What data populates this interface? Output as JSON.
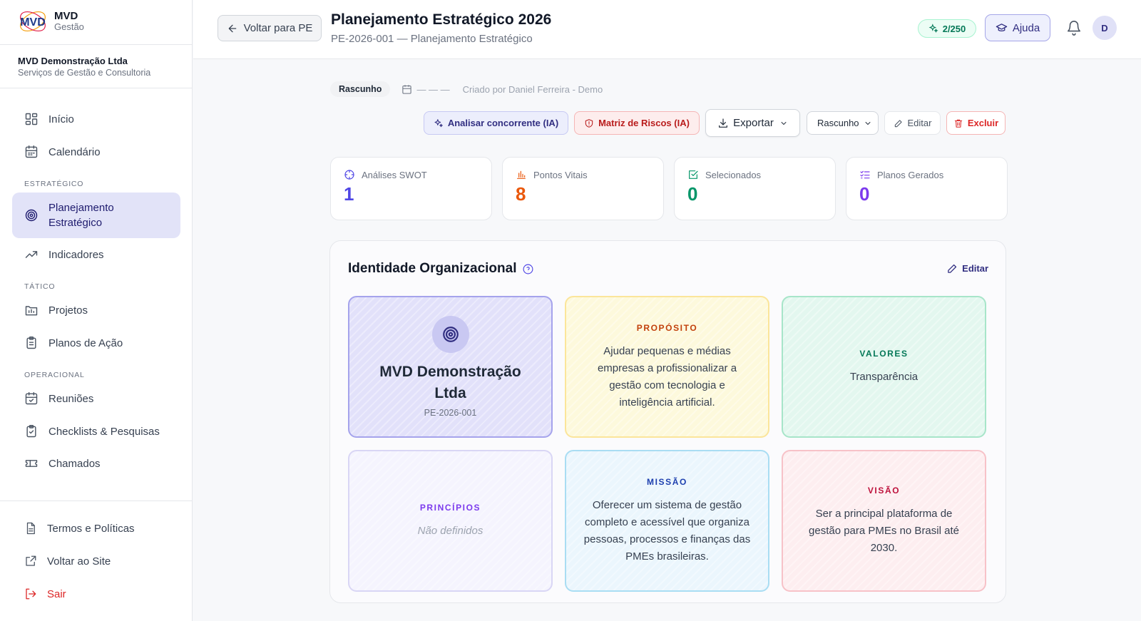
{
  "brand": {
    "title": "MVD",
    "subtitle": "Gestão"
  },
  "company": {
    "name": "MVD Demonstração Ltda",
    "subtitle": "Serviços de Gestão e Consultoria"
  },
  "nav": {
    "inicio": "Início",
    "calendario": "Calendário",
    "section_estrategico": "ESTRATÉGICO",
    "planejamento_1": "Planejamento",
    "planejamento_2": "Estratégico",
    "indicadores": "Indicadores",
    "section_tatico": "TÁTICO",
    "projetos": "Projetos",
    "planos": "Planos de Ação",
    "section_operacional": "OPERACIONAL",
    "reunioes": "Reuniões",
    "checklists": "Checklists & Pesquisas",
    "chamados": "Chamados"
  },
  "nav_bottom": {
    "termos": "Termos e Políticas",
    "voltar_site": "Voltar ao Site",
    "sair": "Sair"
  },
  "header": {
    "back_label": "Voltar para PE",
    "title": "Planejamento Estratégico 2026",
    "subtitle": "PE-2026-001 — Planejamento Estratégico",
    "credits": "2/250",
    "help": "Ajuda",
    "avatar": "D"
  },
  "status": {
    "badge": "Rascunho",
    "date": "— — —",
    "created_by": "Criado por Daniel Ferreira - Demo"
  },
  "actions": {
    "analyze": "Analisar concorrente (IA)",
    "risk": "Matriz de Riscos (IA)",
    "export": "Exportar",
    "status_select": "Rascunho",
    "edit": "Editar",
    "delete": "Excluir"
  },
  "stats": [
    {
      "label": "Análises SWOT",
      "value": "1",
      "color": "#4f46e5"
    },
    {
      "label": "Pontos Vitais",
      "value": "8",
      "color": "#ea580c"
    },
    {
      "label": "Selecionados",
      "value": "0",
      "color": "#059669"
    },
    {
      "label": "Planos Gerados",
      "value": "0",
      "color": "#7c3aed"
    }
  ],
  "identity": {
    "title": "Identidade Organizacional",
    "edit": "Editar",
    "main_name": "MVD Demonstração Ltda",
    "main_code": "PE-2026-001",
    "proposito_h": "PROPÓSITO",
    "proposito_t": "Ajudar pequenas e médias empresas a profissionalizar a gestão com tecnologia e inteligência artificial.",
    "valores_h": "VALORES",
    "valores_t": "Transparência",
    "principios_h": "PRINCÍPIOS",
    "principios_t": "Não definidos",
    "missao_h": "MISSÃO",
    "missao_t": "Oferecer um sistema de gestão completo e acessível que organiza pessoas, processos e finanças das PMEs brasileiras.",
    "visao_h": "VISÃO",
    "visao_t": "Ser a principal plataforma de gestão para PMEs no Brasil até 2030."
  }
}
